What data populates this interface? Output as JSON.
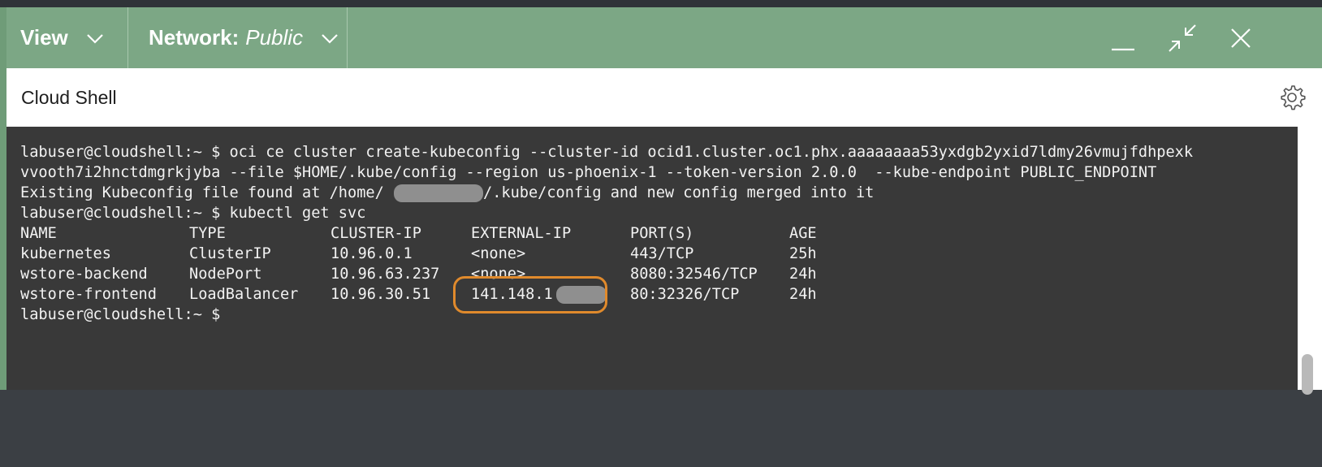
{
  "toolbar": {
    "view_label": "View",
    "network_label": "Network:",
    "network_value": "Public"
  },
  "window_controls": [
    "minimize-icon",
    "restore-icon",
    "close-icon"
  ],
  "header": {
    "title": "Cloud Shell"
  },
  "terminal": {
    "lines": [
      "labuser@cloudshell:~ $ oci ce cluster create-kubeconfig --cluster-id ocid1.cluster.oc1.phx.aaaaaaaa53yxdgb2yxid7ldmy26vmujfdhpexk",
      "vvooth7i2hnctdmgrkjyba --file $HOME/.kube/config --region us-phoenix-1 --token-version 2.0.0  --kube-endpoint PUBLIC_ENDPOINT",
      "Existing Kubeconfig file found at /home/",
      "/.kube/config and new config merged into it",
      "labuser@cloudshell:~ $ kubectl get svc",
      "labuser@cloudshell:~ $"
    ],
    "table": {
      "headers": [
        "NAME",
        "TYPE",
        "CLUSTER-IP",
        "EXTERNAL-IP",
        "PORT(S)",
        "AGE"
      ],
      "rows": [
        [
          "kubernetes",
          "ClusterIP",
          "10.96.0.1",
          "<none>",
          "443/TCP",
          "25h"
        ],
        [
          "wstore-backend",
          "NodePort",
          "10.96.63.237",
          "<none>",
          "8080:32546/TCP",
          "24h"
        ],
        [
          "wstore-frontend",
          "LoadBalancer",
          "10.96.30.51",
          "141.148.1",
          "80:32326/TCP",
          "24h"
        ]
      ]
    }
  },
  "colors": {
    "toolbar_bg": "#7ca785",
    "terminal_bg": "#393939",
    "highlight": "#e08a2c"
  }
}
